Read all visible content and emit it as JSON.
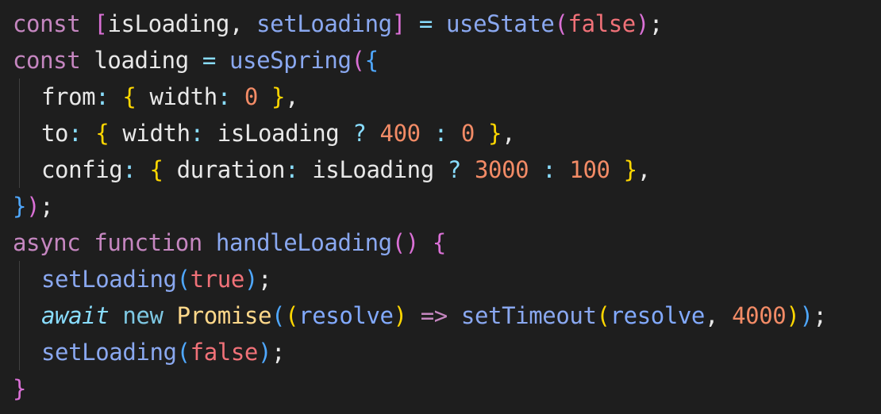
{
  "editor": {
    "lines": [
      [
        {
          "t": "const",
          "c": "t-kw"
        },
        {
          "t": " ",
          "c": "t-plain"
        },
        {
          "t": "[",
          "c": "t-b2"
        },
        {
          "t": "isLoading",
          "c": "t-prop"
        },
        {
          "t": ", ",
          "c": "t-plain"
        },
        {
          "t": "setLoading",
          "c": "t-fn"
        },
        {
          "t": "]",
          "c": "t-b2"
        },
        {
          "t": " = ",
          "c": "t-op"
        },
        {
          "t": "useState",
          "c": "t-fn"
        },
        {
          "t": "(",
          "c": "t-b2"
        },
        {
          "t": "false",
          "c": "t-bool"
        },
        {
          "t": ")",
          "c": "t-b2"
        },
        {
          "t": ";",
          "c": "t-plain"
        }
      ],
      [
        {
          "t": "const",
          "c": "t-kw"
        },
        {
          "t": " loading ",
          "c": "t-plain"
        },
        {
          "t": "=",
          "c": "t-op"
        },
        {
          "t": " ",
          "c": "t-plain"
        },
        {
          "t": "useSpring",
          "c": "t-fn"
        },
        {
          "t": "(",
          "c": "t-b2"
        },
        {
          "t": "{",
          "c": "t-b3"
        }
      ],
      [
        {
          "t": "from",
          "c": "t-prop"
        },
        {
          "t": ": ",
          "c": "t-op"
        },
        {
          "t": "{",
          "c": "t-b1"
        },
        {
          "t": " width",
          "c": "t-prop"
        },
        {
          "t": ": ",
          "c": "t-op"
        },
        {
          "t": "0",
          "c": "t-num"
        },
        {
          "t": " ",
          "c": "t-plain"
        },
        {
          "t": "}",
          "c": "t-b1"
        },
        {
          "t": ",",
          "c": "t-plain"
        }
      ],
      [
        {
          "t": "to",
          "c": "t-prop"
        },
        {
          "t": ": ",
          "c": "t-op"
        },
        {
          "t": "{",
          "c": "t-b1"
        },
        {
          "t": " width",
          "c": "t-prop"
        },
        {
          "t": ": ",
          "c": "t-op"
        },
        {
          "t": "isLoading ",
          "c": "t-prop"
        },
        {
          "t": "?",
          "c": "t-op"
        },
        {
          "t": " ",
          "c": "t-plain"
        },
        {
          "t": "400",
          "c": "t-num"
        },
        {
          "t": " ",
          "c": "t-plain"
        },
        {
          "t": ":",
          "c": "t-op"
        },
        {
          "t": " ",
          "c": "t-plain"
        },
        {
          "t": "0",
          "c": "t-num"
        },
        {
          "t": " ",
          "c": "t-plain"
        },
        {
          "t": "}",
          "c": "t-b1"
        },
        {
          "t": ",",
          "c": "t-plain"
        }
      ],
      [
        {
          "t": "config",
          "c": "t-prop"
        },
        {
          "t": ": ",
          "c": "t-op"
        },
        {
          "t": "{",
          "c": "t-b1"
        },
        {
          "t": " duration",
          "c": "t-prop"
        },
        {
          "t": ": ",
          "c": "t-op"
        },
        {
          "t": "isLoading ",
          "c": "t-prop"
        },
        {
          "t": "?",
          "c": "t-op"
        },
        {
          "t": " ",
          "c": "t-plain"
        },
        {
          "t": "3000",
          "c": "t-num"
        },
        {
          "t": " ",
          "c": "t-plain"
        },
        {
          "t": ":",
          "c": "t-op"
        },
        {
          "t": " ",
          "c": "t-plain"
        },
        {
          "t": "100",
          "c": "t-num"
        },
        {
          "t": " ",
          "c": "t-plain"
        },
        {
          "t": "}",
          "c": "t-b1"
        },
        {
          "t": ",",
          "c": "t-plain"
        }
      ],
      [
        {
          "t": "}",
          "c": "t-b3"
        },
        {
          "t": ")",
          "c": "t-b2"
        },
        {
          "t": ";",
          "c": "t-plain"
        }
      ],
      [
        {
          "t": "async",
          "c": "t-kw"
        },
        {
          "t": " ",
          "c": "t-plain"
        },
        {
          "t": "function",
          "c": "t-kw"
        },
        {
          "t": " ",
          "c": "t-plain"
        },
        {
          "t": "handleLoading",
          "c": "t-fn"
        },
        {
          "t": "()",
          "c": "t-b2"
        },
        {
          "t": " ",
          "c": "t-plain"
        },
        {
          "t": "{",
          "c": "t-b2"
        }
      ],
      [
        {
          "t": "setLoading",
          "c": "t-fn"
        },
        {
          "t": "(",
          "c": "t-b3"
        },
        {
          "t": "true",
          "c": "t-bool"
        },
        {
          "t": ")",
          "c": "t-b3"
        },
        {
          "t": ";",
          "c": "t-plain"
        }
      ],
      [
        {
          "t": "await",
          "c": "t-await"
        },
        {
          "t": " ",
          "c": "t-plain"
        },
        {
          "t": "new",
          "c": "t-new"
        },
        {
          "t": " ",
          "c": "t-plain"
        },
        {
          "t": "Promise",
          "c": "t-class"
        },
        {
          "t": "(",
          "c": "t-b3"
        },
        {
          "t": "(",
          "c": "t-b1"
        },
        {
          "t": "resolve",
          "c": "t-param"
        },
        {
          "t": ")",
          "c": "t-b1"
        },
        {
          "t": " ",
          "c": "t-plain"
        },
        {
          "t": "=>",
          "c": "t-kw"
        },
        {
          "t": " ",
          "c": "t-plain"
        },
        {
          "t": "setTimeout",
          "c": "t-fn"
        },
        {
          "t": "(",
          "c": "t-b1"
        },
        {
          "t": "resolve",
          "c": "t-param"
        },
        {
          "t": ", ",
          "c": "t-plain"
        },
        {
          "t": "4000",
          "c": "t-num"
        },
        {
          "t": ")",
          "c": "t-b1"
        },
        {
          "t": ")",
          "c": "t-b3"
        },
        {
          "t": ";",
          "c": "t-plain"
        }
      ],
      [
        {
          "t": "setLoading",
          "c": "t-fn"
        },
        {
          "t": "(",
          "c": "t-b3"
        },
        {
          "t": "false",
          "c": "t-bool"
        },
        {
          "t": ")",
          "c": "t-b3"
        },
        {
          "t": ";",
          "c": "t-plain"
        }
      ],
      [
        {
          "t": "}",
          "c": "t-b2"
        }
      ]
    ],
    "indented_lines": [
      2,
      3,
      4,
      7,
      8,
      9
    ]
  }
}
